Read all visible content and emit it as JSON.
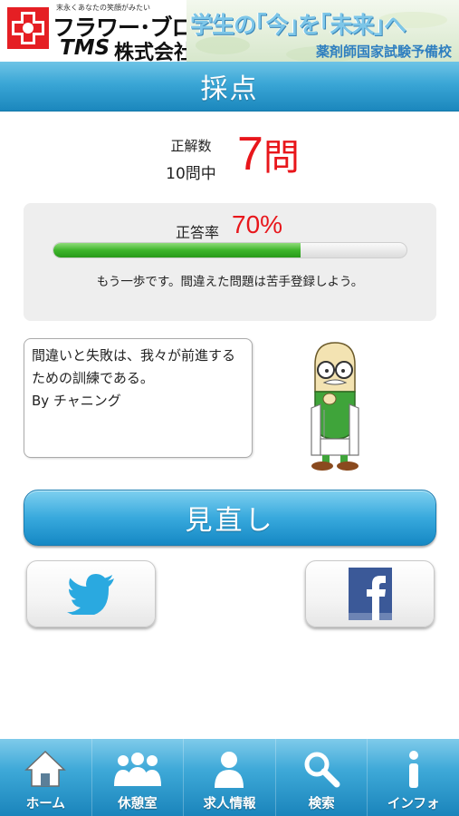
{
  "banner": {
    "tagline": "末永くあなたの笑顔がみたい",
    "brand_name": "フラワー･ブロス",
    "brand_tms": "TMS",
    "brand_company": "株式会社",
    "slogan": "学生の｢今｣を｢未来｣へ",
    "school": "薬剤師国家試験予備校"
  },
  "title": "採点",
  "score": {
    "label_correct": "正解数",
    "label_total": "10問中",
    "value": "7",
    "unit": "問"
  },
  "rate": {
    "label": "正答率",
    "value": "70%",
    "progress_fraction": 0.7,
    "advice": "もう一歩です。間違えた問題は苦手登録しよう。"
  },
  "quote": {
    "line1": "間違いと失敗は、我々が前進する",
    "line2": "ための訓練である。",
    "line3": "By チャニング"
  },
  "review_button": "見直し",
  "social": {
    "twitter_icon": "twitter-bird-icon",
    "facebook_icon": "facebook-f-icon"
  },
  "nav": {
    "items": [
      {
        "label": "ホーム",
        "icon": "home-icon"
      },
      {
        "label": "休憩室",
        "icon": "people-icon"
      },
      {
        "label": "求人情報",
        "icon": "person-icon"
      },
      {
        "label": "検索",
        "icon": "search-icon"
      },
      {
        "label": "インフォ",
        "icon": "info-icon"
      }
    ]
  },
  "colors": {
    "accent_blue": "#3aa6d6",
    "score_red": "#e8161b",
    "progress_green": "#3eb52b"
  }
}
